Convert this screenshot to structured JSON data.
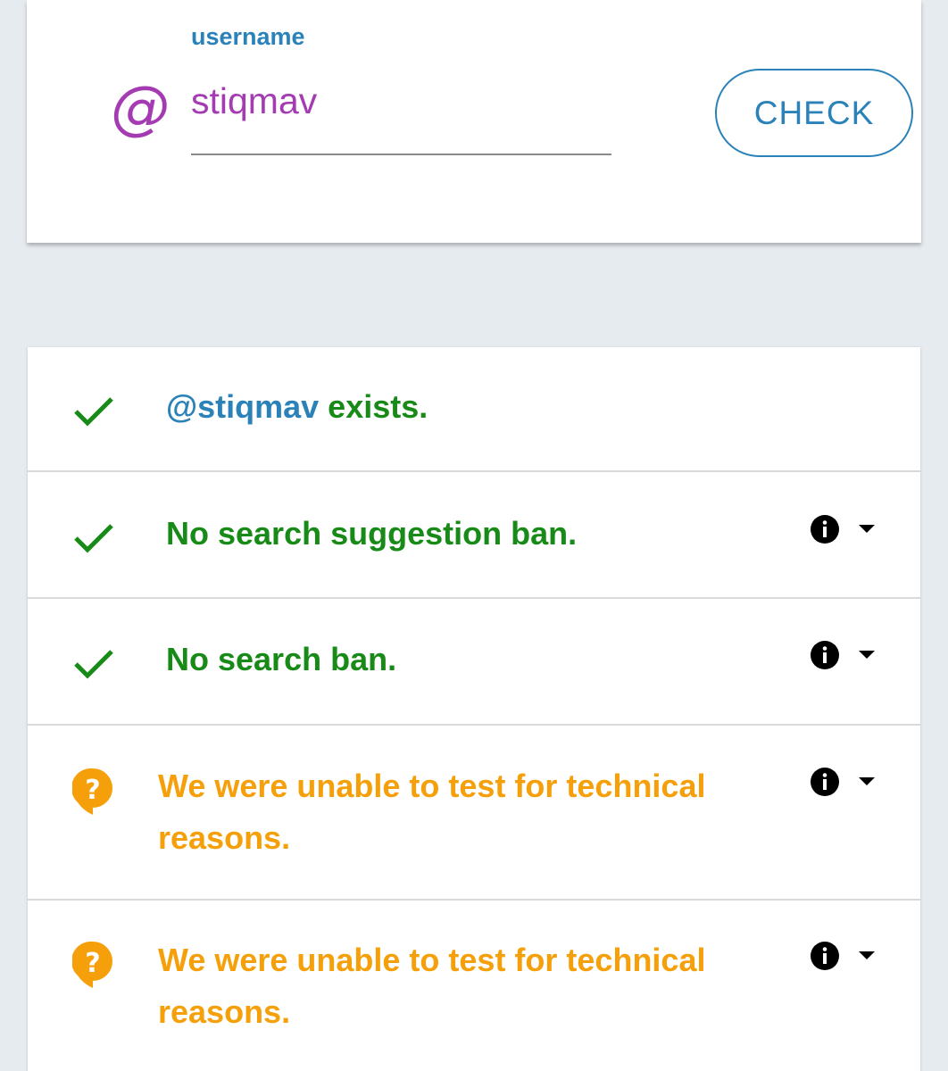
{
  "search": {
    "label": "username",
    "at_symbol": "@",
    "value": "stiqmav",
    "button_label": "CHECK"
  },
  "results": [
    {
      "status": "ok",
      "icon": "check-icon",
      "username": "@stiqmav",
      "text": " exists.",
      "has_info": false
    },
    {
      "status": "ok",
      "icon": "check-icon",
      "text": "No search suggestion ban.",
      "has_info": true
    },
    {
      "status": "ok",
      "icon": "check-icon",
      "text": "No search ban.",
      "has_info": true
    },
    {
      "status": "unknown",
      "icon": "question-bubble-icon",
      "text": "We were unable to test for technical reasons.",
      "has_info": true
    },
    {
      "status": "unknown",
      "icon": "question-bubble-icon",
      "text": "We were unable to test for technical reasons.",
      "has_info": true
    }
  ],
  "colors": {
    "ok": "#178a17",
    "warning": "#f5a00a",
    "accent": "#2a82b8",
    "username": "#a43bb2",
    "background": "#e6ebef"
  }
}
